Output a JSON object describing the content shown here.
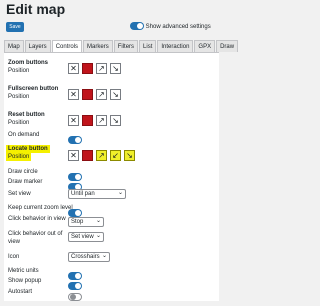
{
  "page": {
    "title": "Edit map",
    "save_label": "Save",
    "advanced_label": "Show advanced settings"
  },
  "tabs": [
    "Map",
    "Layers",
    "Controls",
    "Markers",
    "Filters",
    "List",
    "Interaction",
    "GPX",
    "Draw"
  ],
  "controls": {
    "zoom": {
      "title": "Zoom buttons",
      "position": "Position"
    },
    "fullscreen": {
      "title": "Fullscreen button",
      "position": "Position"
    },
    "reset": {
      "title": "Reset button",
      "position": "Position",
      "on_demand": "On demand"
    },
    "locate": {
      "title": "Locate button",
      "position": "Position",
      "draw_circle": "Draw circle",
      "draw_marker": "Draw marker",
      "set_view": "Set view",
      "set_view_value": "Until pan",
      "keep_zoom": "Keep current zoom level",
      "click_in_view": "Click behavior in view",
      "click_in_view_value": "Stop",
      "click_out_view": "Click behavior out of view",
      "click_out_view_value": "Set view",
      "icon": "Icon",
      "icon_value": "Crosshairs",
      "metric": "Metric units",
      "popup": "Show popup",
      "autostart": "Autostart"
    }
  },
  "icons": [
    "close-icon",
    "red-square",
    "arrow-up-right-icon",
    "arrow-down-right-icon"
  ],
  "colors": {
    "accent": "#2271b1",
    "red": "#c0141b",
    "highlight": "#f5f000"
  }
}
